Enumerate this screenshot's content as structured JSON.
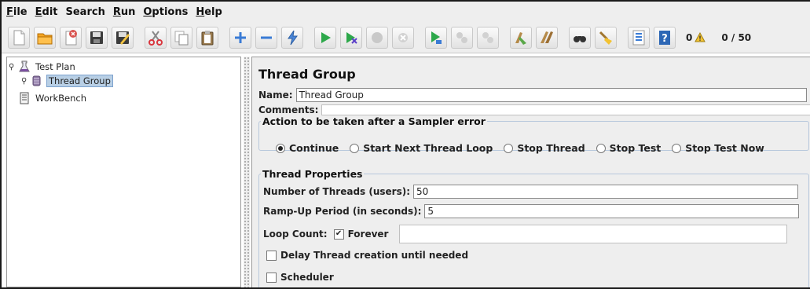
{
  "menubar": [
    {
      "label": "File",
      "mnemonic": "F",
      "rest": "ile"
    },
    {
      "label": "Edit",
      "mnemonic": "E",
      "rest": "dit"
    },
    {
      "label": "Search",
      "mnemonic": "",
      "rest": "Search"
    },
    {
      "label": "Run",
      "mnemonic": "R",
      "rest": "un"
    },
    {
      "label": "Options",
      "mnemonic": "O",
      "rest": "ptions"
    },
    {
      "label": "Help",
      "mnemonic": "H",
      "rest": "elp"
    }
  ],
  "toolbar": {
    "error_count": "0",
    "thread_ratio": "0 / 50",
    "icons": [
      "new-icon",
      "open-icon",
      "close-icon",
      "save-icon",
      "save-as-icon",
      "cut-icon",
      "copy-icon",
      "paste-icon",
      "expand-icon",
      "collapse-icon",
      "toggle-icon",
      "start-icon",
      "start-no-pause-icon",
      "stop-icon",
      "shutdown-icon",
      "remote-start-icon",
      "remote-stop-icon",
      "remote-shutdown-icon",
      "clear-icon",
      "clear-all-icon",
      "search-icon",
      "reset-search-icon",
      "function-helper-icon",
      "help-icon"
    ]
  },
  "tree": {
    "test_plan": "Test Plan",
    "thread_group": "Thread Group",
    "workbench": "WorkBench"
  },
  "panel": {
    "title": "Thread Group",
    "name_label": "Name:",
    "name_value": "Thread Group",
    "comments_label": "Comments:",
    "comments_value": "",
    "sampler_error_legend": "Action to be taken after a Sampler error",
    "actions": [
      {
        "label": "Continue",
        "selected": true
      },
      {
        "label": "Start Next Thread Loop",
        "selected": false
      },
      {
        "label": "Stop Thread",
        "selected": false
      },
      {
        "label": "Stop Test",
        "selected": false
      },
      {
        "label": "Stop Test Now",
        "selected": false
      }
    ],
    "thread_props_legend": "Thread Properties",
    "threads_label": "Number of Threads (users):",
    "threads_value": "50",
    "rampup_label": "Ramp-Up Period (in seconds):",
    "rampup_value": "5",
    "loop_label": "Loop Count:",
    "forever_label": "Forever",
    "forever_checked": true,
    "loop_value": "",
    "delay_label": "Delay Thread creation until needed",
    "delay_checked": false,
    "scheduler_label": "Scheduler",
    "scheduler_checked": false
  }
}
